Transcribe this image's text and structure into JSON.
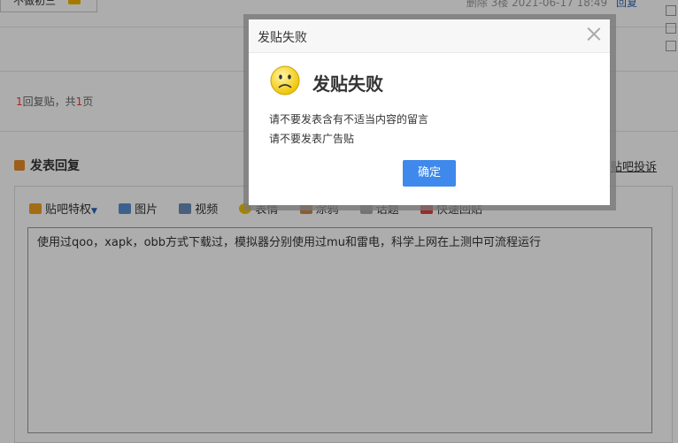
{
  "top": {
    "user_text": "不做初三",
    "meta": "删除  3楼  2021-06-17 18:49",
    "reply_link": "回复"
  },
  "pager": {
    "current": "1",
    "label_mid": "回复贴，共",
    "total": "1",
    "label_end": "页"
  },
  "reply": {
    "title": "发表回复",
    "report": "贴吧投诉"
  },
  "toolbar": {
    "items": [
      {
        "label": "贴吧特权",
        "icon": "crown-icon"
      },
      {
        "label": "图片",
        "icon": "image-icon"
      },
      {
        "label": "视频",
        "icon": "video-icon"
      },
      {
        "label": "表情",
        "icon": "emoji-icon"
      },
      {
        "label": "涂鸦",
        "icon": "doodle-icon"
      },
      {
        "label": "话题",
        "icon": "topic-icon"
      },
      {
        "label": "快速回贴",
        "icon": "quick-reply-icon"
      }
    ]
  },
  "editor": {
    "content": "使用过qoo，xapk，obb方式下载过，模拟器分别使用过mu和雷电，科学上网在上测中可流程运行"
  },
  "dialog": {
    "title": "发贴失败",
    "headline": "发贴失败",
    "message1": "请不要发表含有不适当内容的留言",
    "message2": "请不要发表广告贴",
    "ok_label": "确定",
    "icon": "sad-face-icon"
  },
  "colors": {
    "accent": "#3f89ec",
    "link": "#2d64b3",
    "highlight": "#ff3333"
  }
}
